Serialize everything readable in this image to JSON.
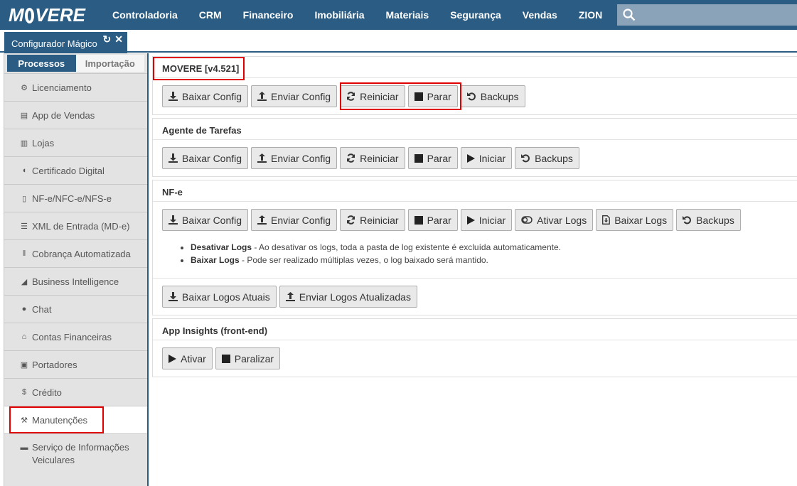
{
  "app": {
    "logo_text": "MOVERE",
    "menu": [
      "Controladoria",
      "CRM",
      "Financeiro",
      "Imobiliária",
      "Materiais",
      "Segurança",
      "Vendas",
      "ZION"
    ],
    "search_placeholder": ""
  },
  "tab": {
    "label": "Configurador Mágico"
  },
  "sidebar": {
    "tabs": [
      "Processos",
      "Importação"
    ],
    "items": [
      {
        "label": "Licenciamento",
        "icon": "key-icon"
      },
      {
        "label": "App de Vendas",
        "icon": "cart-icon"
      },
      {
        "label": "Lojas",
        "icon": "building-icon"
      },
      {
        "label": "Certificado Digital",
        "icon": "shield-icon"
      },
      {
        "label": "NF-e/NFC-e/NFS-e",
        "icon": "file-code-icon"
      },
      {
        "label": "XML de Entrada (MD-e)",
        "icon": "file-text-icon"
      },
      {
        "label": "Cobrança Automatizada",
        "icon": "barcode-icon"
      },
      {
        "label": "Business Intelligence",
        "icon": "area-chart-icon"
      },
      {
        "label": "Chat",
        "icon": "chat-icon"
      },
      {
        "label": "Contas Financeiras",
        "icon": "bank-icon"
      },
      {
        "label": "Portadores",
        "icon": "money-icon"
      },
      {
        "label": "Crédito",
        "icon": "dollar-icon"
      },
      {
        "label": "Manutenções",
        "icon": "wrench-icon"
      },
      {
        "label": "Serviço de Informações Veiculares",
        "icon": "car-icon"
      }
    ]
  },
  "panels": {
    "movere": {
      "title": "MOVERE [v4.521]",
      "buttons": [
        "Baixar Config",
        "Enviar Config",
        "Reiniciar",
        "Parar",
        "Backups"
      ]
    },
    "agente": {
      "title": "Agente de Tarefas",
      "buttons": [
        "Baixar Config",
        "Enviar Config",
        "Reiniciar",
        "Parar",
        "Iniciar",
        "Backups"
      ]
    },
    "nfe": {
      "title": "NF-e",
      "buttons": [
        "Baixar Config",
        "Enviar Config",
        "Reiniciar",
        "Parar",
        "Iniciar",
        "Ativar Logs",
        "Baixar Logs",
        "Backups"
      ],
      "notes": [
        {
          "bold": "Desativar Logs",
          "text": " - Ao desativar os logs, toda a pasta de log existente é excluída automaticamente."
        },
        {
          "bold": "Baixar Logs",
          "text": " - Pode ser realizado múltiplas vezes, o log baixado será mantido."
        }
      ],
      "logo_buttons": [
        "Baixar Logos Atuais",
        "Enviar Logos Atualizadas"
      ]
    },
    "insights": {
      "title": "App Insights (front-end)",
      "buttons": [
        "Ativar",
        "Paralizar"
      ]
    }
  }
}
